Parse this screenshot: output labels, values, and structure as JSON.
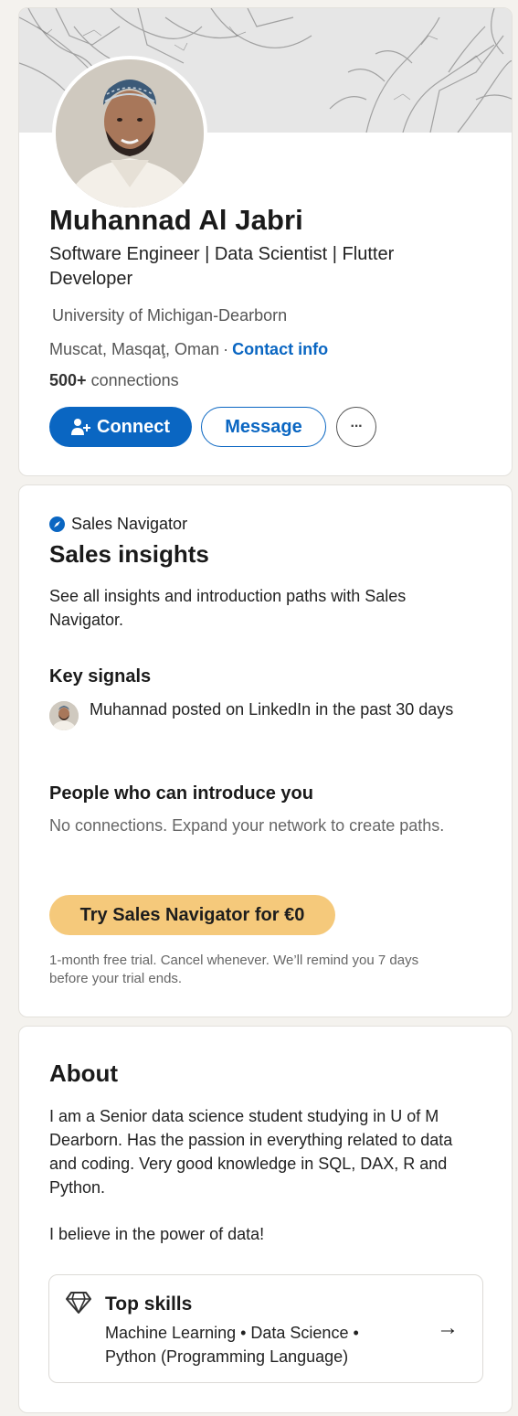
{
  "profile": {
    "name": "Muhannad Al Jabri",
    "headline": "Software Engineer | Data Scientist | Flutter Developer",
    "school": "University of Michigan-Dearborn",
    "location": "Muscat, Masqaţ, Oman",
    "separator": "·",
    "contact_info": "Contact info",
    "connections_count": "500+",
    "connections_label": "connections",
    "buttons": {
      "connect": "Connect",
      "message": "Message",
      "more": "···"
    }
  },
  "sales": {
    "brand": "Sales Navigator",
    "title": "Sales insights",
    "description": "See all insights and introduction paths with Sales Navigator.",
    "key_signals_title": "Key signals",
    "key_signal_text": "Muhannad posted on LinkedIn in the past 30 days",
    "introduce_title": "People who can introduce you",
    "introduce_text": "No connections. Expand your network to create paths.",
    "try_button": "Try Sales Navigator for €0",
    "trial_note": "1-month free trial. Cancel whenever. We’ll remind you 7 days before your trial ends."
  },
  "about": {
    "title": "About",
    "paragraph_1": "I am a Senior data science student studying in U of M Dearborn. Has the passion in everything related to data and coding. Very good knowledge in SQL, DAX, R and Python.",
    "paragraph_2": "I believe in the power of data!",
    "top_skills_title": "Top skills",
    "top_skills_list": "Machine Learning • Data Science • Python (Programming Language)",
    "arrow": "→"
  },
  "colors": {
    "primary": "#0a66c2",
    "premium": "#f5c97b",
    "background": "#f4f2ee"
  },
  "icons": [
    "person-add-icon",
    "compass-icon",
    "gem-icon",
    "arrow-right-icon",
    "more-icon"
  ]
}
